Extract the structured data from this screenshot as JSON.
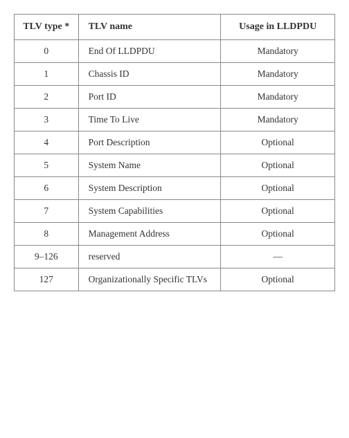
{
  "table": {
    "headers": {
      "type": "TLV type *",
      "name": "TLV name",
      "usage": "Usage in LLDPDU"
    },
    "rows": [
      {
        "type": "0",
        "name": "End Of LLDPDU",
        "usage": "Mandatory"
      },
      {
        "type": "1",
        "name": "Chassis ID",
        "usage": "Mandatory"
      },
      {
        "type": "2",
        "name": "Port ID",
        "usage": "Mandatory"
      },
      {
        "type": "3",
        "name": "Time To Live",
        "usage": "Mandatory"
      },
      {
        "type": "4",
        "name": "Port Description",
        "usage": "Optional"
      },
      {
        "type": "5",
        "name": "System Name",
        "usage": "Optional"
      },
      {
        "type": "6",
        "name": "System Description",
        "usage": "Optional"
      },
      {
        "type": "7",
        "name": "System Capabilities",
        "usage": "Optional"
      },
      {
        "type": "8",
        "name": "Management Address",
        "usage": "Optional"
      },
      {
        "type": "9–126",
        "name": "reserved",
        "usage": "—"
      },
      {
        "type": "127",
        "name": "Organizationally Specific TLVs",
        "usage": "Optional"
      }
    ]
  }
}
